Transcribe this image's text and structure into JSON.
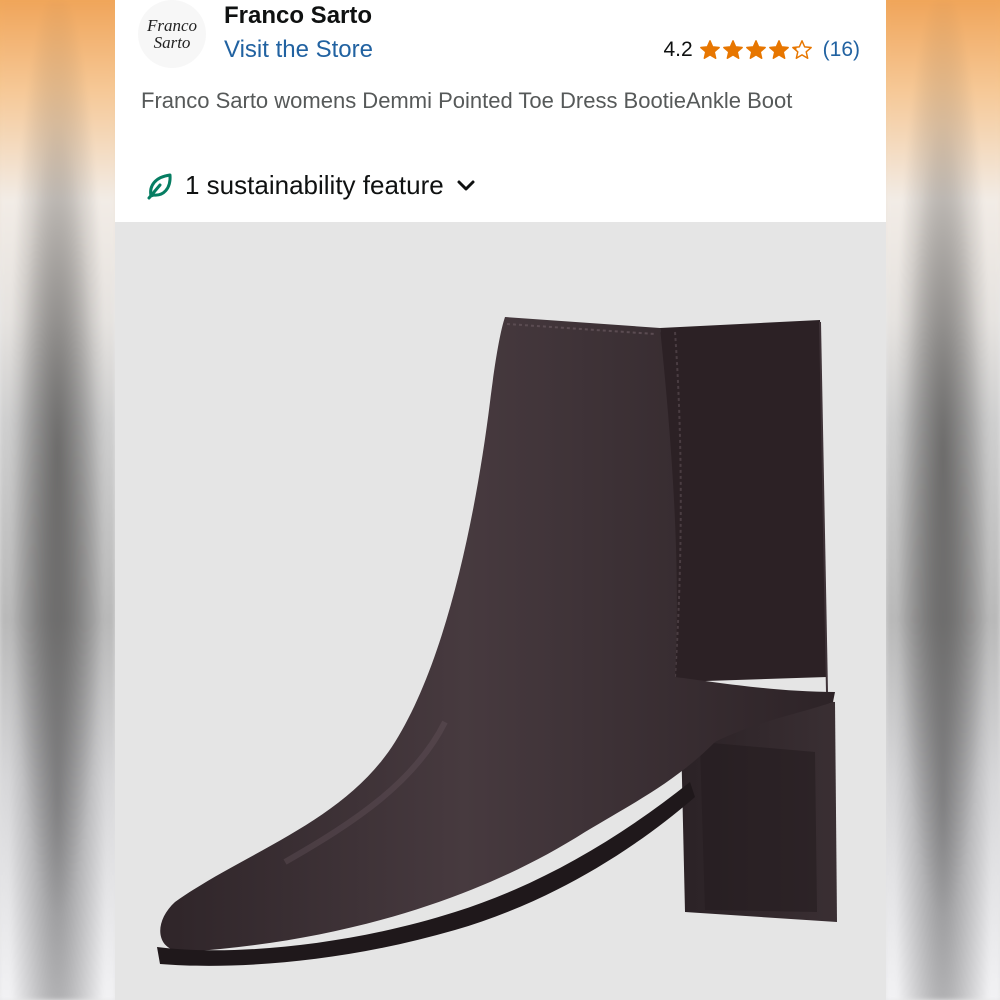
{
  "brand": {
    "name": "Franco Sarto",
    "logo_text_line1": "Franco",
    "logo_text_line2": "Sarto",
    "store_link": "Visit the Store"
  },
  "rating": {
    "score": "4.2",
    "stars": 4.2,
    "stars_max": 5,
    "review_count": "(16)",
    "star_color": "#e77600"
  },
  "product": {
    "title": "Franco Sarto womens Demmi Pointed Toe Dress BootieAnkle Boot",
    "sustainability": "1 sustainability feature",
    "sustainability_icon": "leaf-icon",
    "image": "dark-brown-pointed-toe-chelsea-ankle-boot"
  },
  "colors": {
    "link": "#2162a1",
    "text": "#0f1111",
    "subtle_text": "#565959",
    "leaf": "#067d62",
    "boot": "#3a2f33"
  }
}
